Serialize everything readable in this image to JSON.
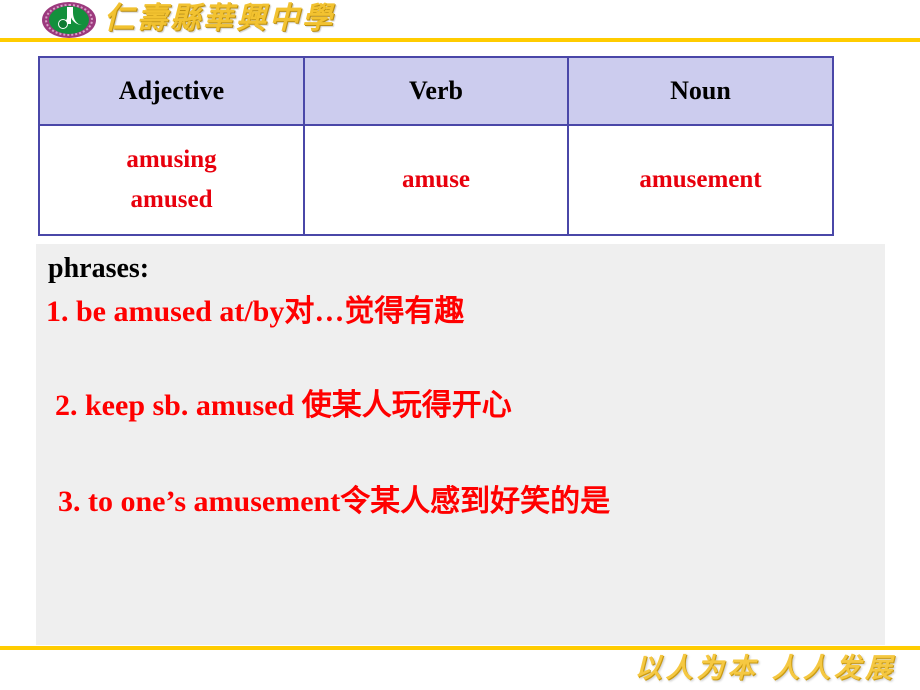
{
  "header": {
    "logo_icon": "school-crest-icon",
    "school_name": "仁壽縣華興中學"
  },
  "table": {
    "headers": [
      "Adjective",
      "Verb",
      "Noun"
    ],
    "rows": [
      {
        "adjective": [
          "amusing",
          "amused"
        ],
        "verb": "amuse",
        "noun": "amusement"
      }
    ]
  },
  "phrases": {
    "heading": "phrases:",
    "items": [
      "1. be amused at/by对…觉得有趣",
      "2. keep sb. amused 使某人玩得开心",
      "3. to one’s amusement令某人感到好笑的是"
    ]
  },
  "footer": {
    "motto": "以人为本  人人发展"
  },
  "colors": {
    "gold_rule": "#ffcc00",
    "table_border": "#4a47a8",
    "table_header_bg": "#ccccee",
    "red_text": "#ff0000",
    "panel_bg": "#efefef",
    "logo_ring": "#9c3a7e",
    "logo_inner": "#13903c"
  }
}
